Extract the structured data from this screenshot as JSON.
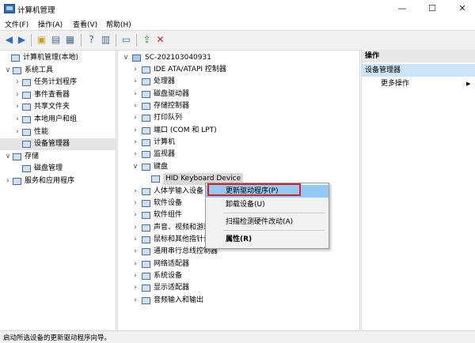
{
  "window": {
    "title": "计算机管理",
    "min": "—",
    "max": "☐",
    "close": "✕"
  },
  "menu": [
    "文件(F)",
    "操作(A)",
    "查看(V)",
    "帮助(H)"
  ],
  "left_tree": [
    {
      "label": "计算机管理(本地)",
      "level": 0,
      "expander": ""
    },
    {
      "label": "系统工具",
      "level": 1,
      "expander": "∨"
    },
    {
      "label": "任务计划程序",
      "level": 2,
      "expander": "›"
    },
    {
      "label": "事件查看器",
      "level": 2,
      "expander": "›"
    },
    {
      "label": "共享文件夹",
      "level": 2,
      "expander": "›"
    },
    {
      "label": "本地用户和组",
      "level": 2,
      "expander": "›"
    },
    {
      "label": "性能",
      "level": 2,
      "expander": "›"
    },
    {
      "label": "设备管理器",
      "level": 2,
      "expander": "",
      "selected": true
    },
    {
      "label": "存储",
      "level": 1,
      "expander": "∨"
    },
    {
      "label": "磁盘管理",
      "level": 2,
      "expander": ""
    },
    {
      "label": "服务和应用程序",
      "level": 1,
      "expander": "›"
    }
  ],
  "device_tree": {
    "root": "SC-202103040931",
    "items": [
      {
        "label": "IDE ATA/ATAPI 控制器",
        "expander": "›"
      },
      {
        "label": "处理器",
        "expander": "›"
      },
      {
        "label": "磁盘驱动器",
        "expander": "›"
      },
      {
        "label": "存储控制器",
        "expander": "›"
      },
      {
        "label": "打印队列",
        "expander": "›"
      },
      {
        "label": "端口 (COM 和 LPT)",
        "expander": "›"
      },
      {
        "label": "计算机",
        "expander": "›"
      },
      {
        "label": "监视器",
        "expander": "›"
      },
      {
        "label": "键盘",
        "expander": "∨"
      },
      {
        "label": "HID Keyboard Device",
        "expander": "",
        "child": true
      },
      {
        "label": "人体学输入设备",
        "expander": "›"
      },
      {
        "label": "软件设备",
        "expander": "›"
      },
      {
        "label": "软件组件",
        "expander": "›"
      },
      {
        "label": "声音、视频和游戏控制器",
        "expander": "›"
      },
      {
        "label": "鼠标和其他指针设备",
        "expander": "›"
      },
      {
        "label": "通用串行总线控制器",
        "expander": "›"
      },
      {
        "label": "网络适配器",
        "expander": "›"
      },
      {
        "label": "系统设备",
        "expander": "›"
      },
      {
        "label": "显示适配器",
        "expander": "›"
      },
      {
        "label": "音频输入和输出",
        "expander": "›"
      }
    ]
  },
  "context_menu": {
    "items": [
      "更新驱动程序(P)",
      "卸载设备(U)",
      "扫描检测硬件改动(A)",
      "属性(R)"
    ]
  },
  "actions": {
    "header": "操作",
    "section": "设备管理器",
    "more": "更多操作",
    "more_arrow": "▶"
  },
  "status": "启动所选设备的更新驱动程序向导。",
  "colors": {
    "selection": "#cce4f7",
    "menu_highlight": "#91c9f7",
    "annotation_box": "#e02020"
  }
}
